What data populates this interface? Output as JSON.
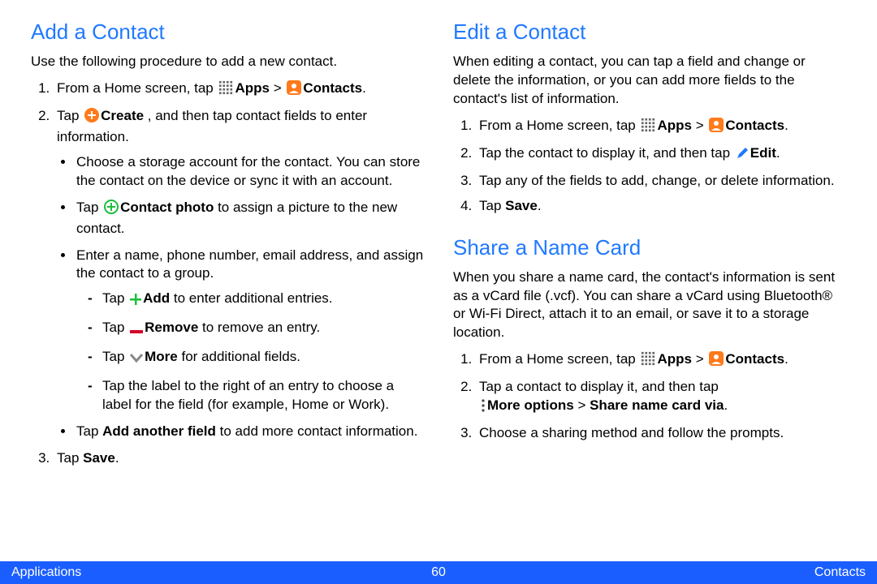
{
  "left": {
    "heading": "Add a Contact",
    "intro": "Use the following procedure to add a new contact.",
    "step1_pre": "From a Home screen, tap ",
    "apps_label": "Apps",
    "contacts_label": "Contacts",
    "step2_pre": "Tap ",
    "create_label": "Create",
    "step2_post": " , and then tap contact fields to enter information.",
    "b1": "Choose a storage account for the contact. You can store the contact on the device or sync it with an account.",
    "b2_pre": "Tap ",
    "contact_photo_label": "Contact photo",
    "b2_post": " to assign a picture to the new contact.",
    "b3": "Enter a name, phone number, email address, and assign the contact to a group.",
    "d1_pre": "Tap ",
    "add_label": "Add",
    "d1_post": " to enter additional entries.",
    "d2_pre": "Tap ",
    "remove_label": "Remove",
    "d2_post": " to remove an entry.",
    "d3_pre": "Tap ",
    "more_label": "More",
    "d3_post": " for additional fields.",
    "d4": "Tap the label to the right of an entry to choose a label for the field (for example, Home or Work).",
    "b4_pre": "Tap ",
    "add_another_field": "Add another field",
    "b4_post": " to add more contact information.",
    "step3_pre": "Tap ",
    "save_label": "Save",
    "step3_post": "."
  },
  "right_edit": {
    "heading": "Edit a Contact",
    "intro": "When editing a contact, you can tap a field and change or delete the information, or you can add more fields to the contact's list of information.",
    "step1_pre": "From a Home screen, tap ",
    "apps_label": "Apps",
    "contacts_label": "Contacts",
    "step2_pre": "Tap the contact to display it, and then tap ",
    "edit_label": "Edit",
    "step3": "Tap any of the fields to add, change, or delete information.",
    "step4_pre": "Tap ",
    "save_label": "Save",
    "step4_post": "."
  },
  "right_share": {
    "heading": "Share a Name Card",
    "intro": "When you share a name card, the contact's information is sent as a vCard file (.vcf). You can share a vCard using Bluetooth® or Wi-Fi Direct, attach it to an email, or save it to a storage location.",
    "step1_pre": "From a Home screen, tap ",
    "apps_label": "Apps",
    "contacts_label": "Contacts",
    "step2_line1": "Tap a contact to display it, and then tap",
    "more_options_label": "More options",
    "share_via_label": "Share name card via",
    "step3": "Choose a sharing method and follow the prompts."
  },
  "footer": {
    "left": "Applications",
    "page": "60",
    "right": "Contacts"
  },
  "greater_than": " > "
}
